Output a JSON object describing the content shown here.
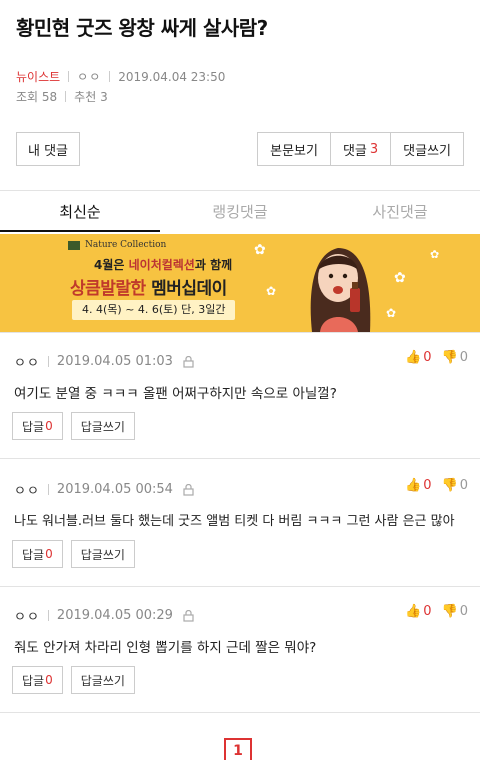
{
  "post": {
    "title": "황민현 굿즈 왕창 싸게 살사람?",
    "board": "뉴이스트",
    "author": "ㅇㅇ",
    "datetime": "2019.04.04 23:50",
    "views_label": "조회 58",
    "likes_label": "추천 3"
  },
  "actions": {
    "my_comment": "내 댓글",
    "view_post": "본문보기",
    "comments_label": "댓글",
    "comments_count": "3",
    "write_comment": "댓글쓰기"
  },
  "tabs": [
    {
      "label": "최신순",
      "active": true
    },
    {
      "label": "랭킹댓글",
      "active": false
    },
    {
      "label": "사진댓글",
      "active": false
    }
  ],
  "banner": {
    "brand": "Nature Collection",
    "line1_pre": "4월은 ",
    "line1_em": "네이처컬렉션",
    "line1_post": "과 함께",
    "line2_em": "상큼발랄한",
    "line2_post": " 멤버십데이",
    "period": "4. 4(목) ~ 4. 6(토) 단, 3일간"
  },
  "comments": [
    {
      "nick": "ㅇㅇ",
      "datetime": "2019.04.05 01:03",
      "up": "0",
      "down": "0",
      "text": "여기도 분열 중 ㅋㅋㅋ 올팬 어쩌구하지만 속으로 아닐껄?",
      "reply_label": "답글",
      "reply_count": "0",
      "write_reply": "답글쓰기"
    },
    {
      "nick": "ㅇㅇ",
      "datetime": "2019.04.05 00:54",
      "up": "0",
      "down": "0",
      "text": "나도 워너블.러브 둘다 했는데 굿즈 앨범 티켓 다 버림 ㅋㅋㅋ 그런 사람 은근 많아",
      "reply_label": "답글",
      "reply_count": "0",
      "write_reply": "답글쓰기"
    },
    {
      "nick": "ㅇㅇ",
      "datetime": "2019.04.05 00:29",
      "up": "0",
      "down": "0",
      "text": "줘도 안가져 차라리 인형 뽑기를 하지 근데 짤은 뭐야?",
      "reply_label": "답글",
      "reply_count": "0",
      "write_reply": "답글쓰기"
    }
  ],
  "pagination": {
    "current": "1"
  },
  "colors": {
    "accent": "#dd3333",
    "banner_bg": "#f7c341"
  }
}
